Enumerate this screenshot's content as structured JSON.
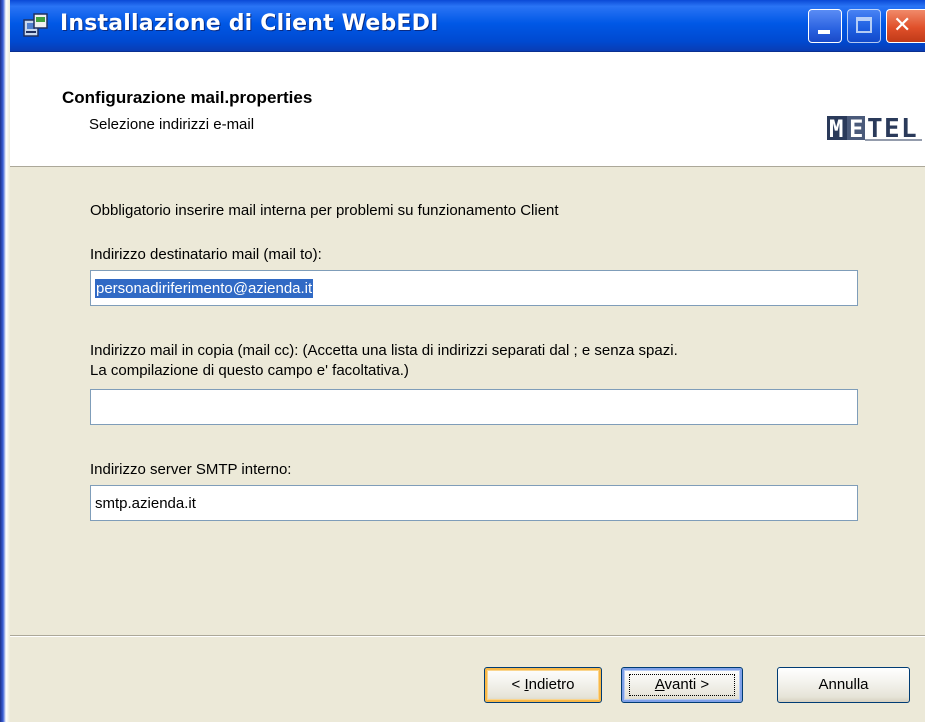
{
  "window": {
    "title": "Installazione di Client WebEDI",
    "icon": "installer-icon",
    "controls": {
      "minimize": "minimize-icon",
      "maximize": "maximize-icon",
      "close": "close-icon"
    }
  },
  "header": {
    "title": "Configurazione mail.properties",
    "subtitle": "Selezione indirizzi e-mail",
    "logo_text": "METEL"
  },
  "form": {
    "instructions": "Obbligatorio inserire mail interna per problemi su funzionamento Client",
    "mail_to": {
      "label": "Indirizzo destinatario mail (mail to):",
      "value": "personadiriferimento@azienda.it",
      "selected": true
    },
    "mail_cc": {
      "label_line1": "Indirizzo mail in copia (mail cc): (Accetta una lista di indirizzi separati dal ; e senza spazi.",
      "label_line2": "La compilazione di questo campo e' facoltativa.)",
      "value": ""
    },
    "smtp": {
      "label": "Indirizzo server SMTP interno:",
      "value": "smtp.azienda.it"
    }
  },
  "buttons": {
    "back_prefix": "< ",
    "back_mnemonic": "I",
    "back_rest": "ndietro",
    "next_mnemonic": "A",
    "next_rest": "vanti >",
    "cancel": "Annulla"
  },
  "colors": {
    "titlebar": "#0058e6",
    "dialog_bg": "#ece9d8",
    "selection": "#316ac5",
    "close_button": "#e0502a"
  }
}
